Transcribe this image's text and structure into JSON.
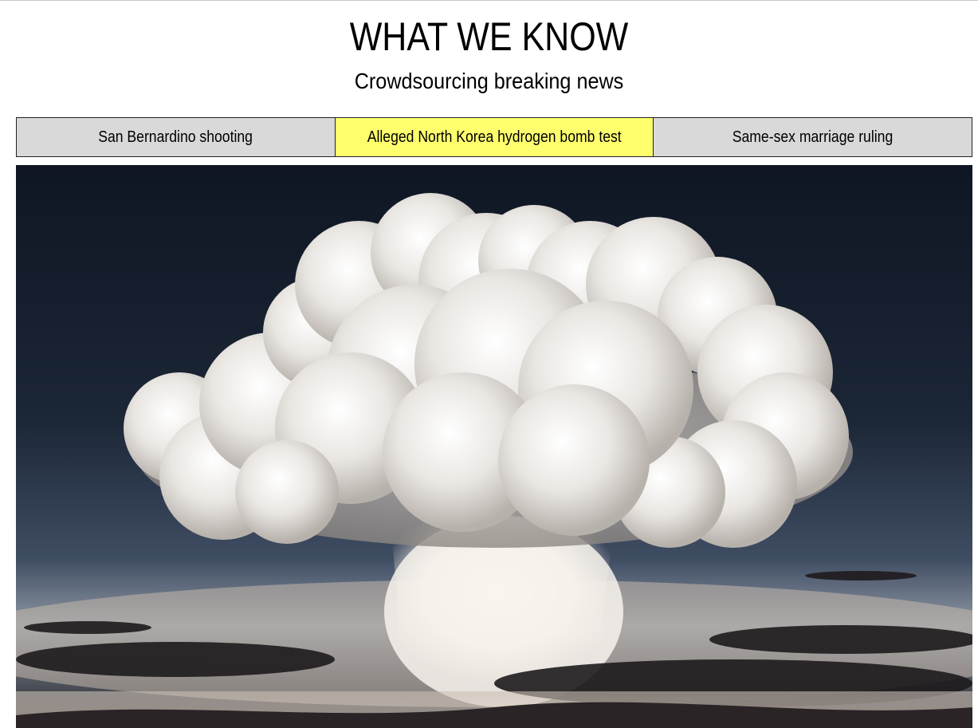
{
  "header": {
    "title": "WHAT WE KNOW",
    "subtitle": "Crowdsourcing breaking news"
  },
  "tabs": [
    {
      "label": "San Bernardino shooting",
      "active": false
    },
    {
      "label": "Alleged North Korea hydrogen bomb test",
      "active": true
    },
    {
      "label": "Same-sex marriage ruling",
      "active": false
    }
  ],
  "colors": {
    "active_tab": "#ffff6e",
    "inactive_tab": "#d9d9d9",
    "tab_border": "#222222"
  },
  "hero": {
    "subject": "mushroom-cloud-photo"
  }
}
